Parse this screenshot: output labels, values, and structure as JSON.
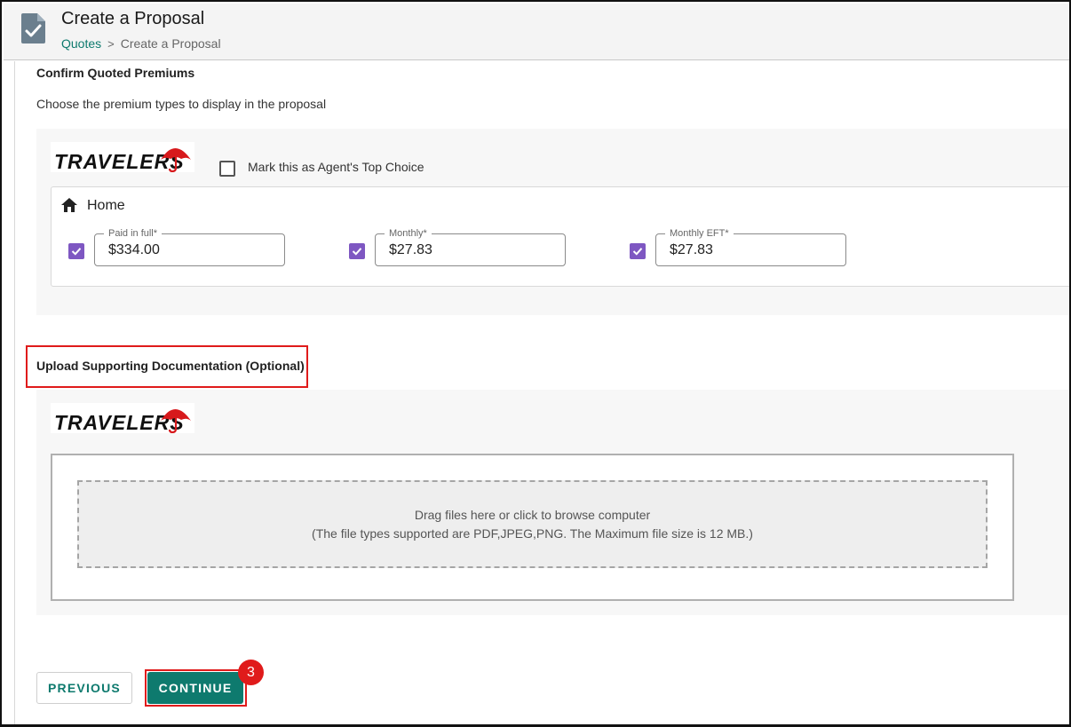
{
  "header": {
    "title": "Create a Proposal",
    "breadcrumb": {
      "link": "Quotes",
      "separator": ">",
      "current": "Create a Proposal"
    }
  },
  "premiums": {
    "title": "Confirm Quoted Premiums",
    "subtitle": "Choose the premium types to display in the proposal",
    "carrier_logo": "TRAVELERS",
    "top_choice_label": "Mark this as Agent's Top Choice",
    "top_choice_checked": false,
    "line": "Home",
    "fields": [
      {
        "label": "Paid in full*",
        "value": "$334.00",
        "checked": true
      },
      {
        "label": "Monthly*",
        "value": "$27.83",
        "checked": true
      },
      {
        "label": "Monthly EFT*",
        "value": "$27.83",
        "checked": true
      }
    ]
  },
  "upload": {
    "title": "Upload Supporting Documentation (Optional)",
    "carrier_logo": "TRAVELERS",
    "drop_text": "Drag files here or click to browse computer",
    "drop_hint": "(The file types supported are PDF,JPEG,PNG. The Maximum file size is 12 MB.)"
  },
  "footer": {
    "previous_label": "PREVIOUS",
    "continue_label": "CONTINUE",
    "step_badge": "3"
  },
  "colors": {
    "accent": "#0e7a6e",
    "checkbox": "#7e57c2",
    "highlight": "#e01b1b",
    "logo_red": "#d7191c"
  }
}
